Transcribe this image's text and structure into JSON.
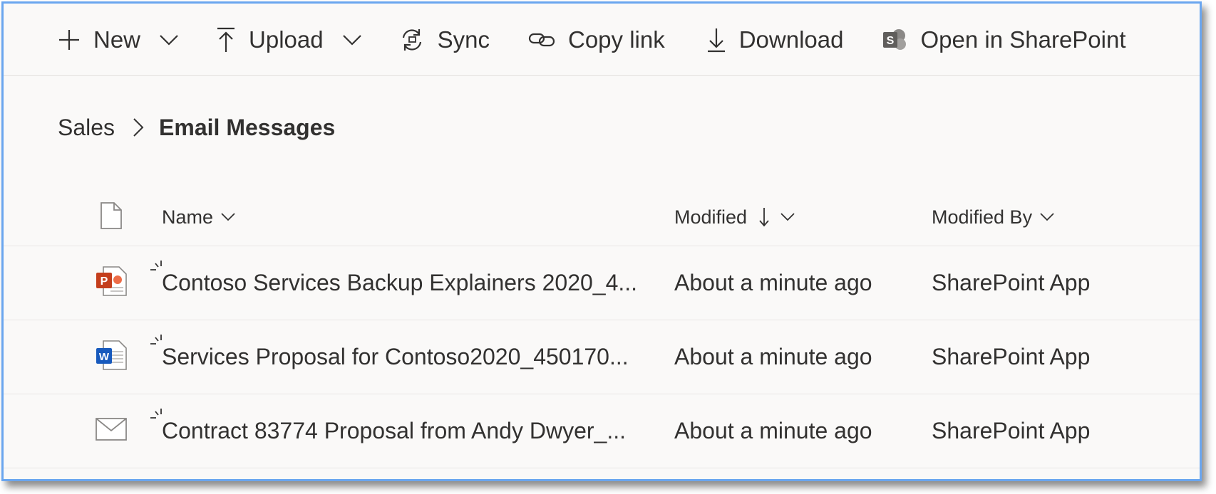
{
  "toolbar": {
    "new_label": "New",
    "upload_label": "Upload",
    "sync_label": "Sync",
    "copy_link_label": "Copy link",
    "download_label": "Download",
    "open_sharepoint_label": "Open in SharePoint"
  },
  "breadcrumb": {
    "root": "Sales",
    "current": "Email Messages"
  },
  "columns": {
    "name": "Name",
    "modified": "Modified",
    "modified_by": "Modified By"
  },
  "files": [
    {
      "name": "Contoso Services Backup Explainers 2020_4...",
      "modified": "About a minute ago",
      "modified_by": "SharePoint App",
      "icon": "powerpoint-icon"
    },
    {
      "name": "Services Proposal for Contoso2020_450170...",
      "modified": "About a minute ago",
      "modified_by": "SharePoint App",
      "icon": "word-icon"
    },
    {
      "name": "Contract 83774 Proposal from Andy Dwyer_...",
      "modified": "About a minute ago",
      "modified_by": "SharePoint App",
      "icon": "email-icon"
    }
  ],
  "colors": {
    "frame_border": "#6aa6ef",
    "background": "#faf9f8",
    "powerpoint": "#c43e1c",
    "word": "#185abd"
  }
}
